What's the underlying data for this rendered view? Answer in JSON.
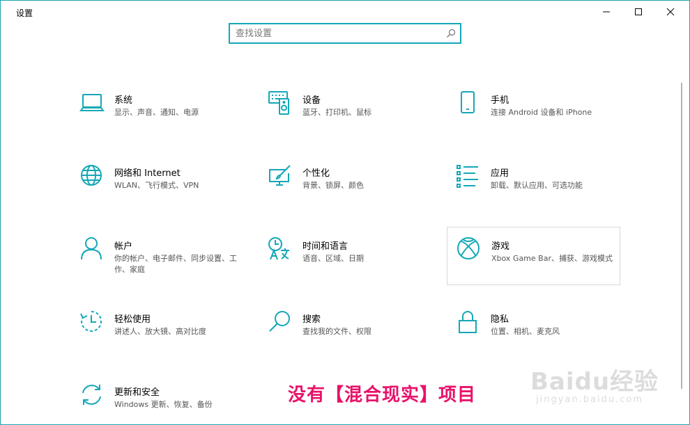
{
  "window": {
    "title": "设置"
  },
  "search": {
    "placeholder": "查找设置"
  },
  "tiles": [
    {
      "name": "系统",
      "desc": "显示、声音、通知、电源",
      "icon": "laptop-icon"
    },
    {
      "name": "设备",
      "desc": "蓝牙、打印机、鼠标",
      "icon": "devices-icon"
    },
    {
      "name": "手机",
      "desc": "连接 Android 设备和 iPhone",
      "icon": "phone-icon"
    },
    {
      "name": "网络和 Internet",
      "desc": "WLAN、飞行模式、VPN",
      "icon": "globe-icon"
    },
    {
      "name": "个性化",
      "desc": "背景、锁屏、颜色",
      "icon": "personalization-icon"
    },
    {
      "name": "应用",
      "desc": "卸载、默认应用、可选功能",
      "icon": "apps-list-icon"
    },
    {
      "name": "帐户",
      "desc": "你的帐户、电子邮件、同步设置、工作、家庭",
      "icon": "person-icon"
    },
    {
      "name": "时间和语言",
      "desc": "语音、区域、日期",
      "icon": "time-language-icon"
    },
    {
      "name": "游戏",
      "desc": "Xbox Game Bar、捕获、游戏模式",
      "icon": "xbox-icon"
    },
    {
      "name": "轻松使用",
      "desc": "讲述人、放大镜、高对比度",
      "icon": "ease-of-access-icon"
    },
    {
      "name": "搜索",
      "desc": "查找我的文件、权限",
      "icon": "search-icon"
    },
    {
      "name": "隐私",
      "desc": "位置、相机、麦克风",
      "icon": "lock-icon"
    },
    {
      "name": "更新和安全",
      "desc": "Windows 更新、恢复、备份",
      "icon": "sync-icon"
    }
  ],
  "overlay": {
    "text": "没有【混合现实】项目"
  },
  "watermark": {
    "main": "Baidu经验",
    "sub": "jingyan.baidu.com"
  },
  "colors": {
    "accent": "#14a7b7",
    "overlay": "#e8126a"
  }
}
